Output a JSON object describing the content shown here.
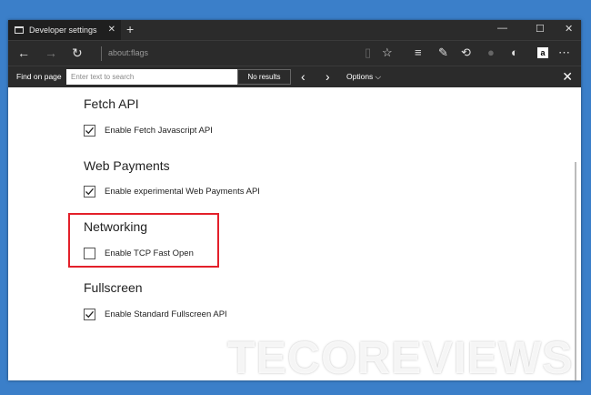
{
  "tab": {
    "title": "Developer settings",
    "close": "✕"
  },
  "window": {
    "minimize": "—",
    "maximize": "☐",
    "close": "✕"
  },
  "address": {
    "url": "about:flags"
  },
  "findbar": {
    "label": "Find on page",
    "placeholder": "Enter text to search",
    "results": "No results",
    "options": "Options ⌵"
  },
  "sections": [
    {
      "heading": "Fetch API",
      "option": "Enable Fetch Javascript API",
      "checked": true
    },
    {
      "heading": "Web Payments",
      "option": "Enable experimental Web Payments API",
      "checked": true
    },
    {
      "heading": "Networking",
      "option": "Enable TCP Fast Open",
      "checked": false
    },
    {
      "heading": "Fullscreen",
      "option": "Enable Standard Fullscreen API",
      "checked": true
    }
  ],
  "watermark": "TECOREVIEWS",
  "colors": {
    "highlight": "#e3202a",
    "chrome": "#2b2b2b",
    "background": "#3b7fc9"
  }
}
